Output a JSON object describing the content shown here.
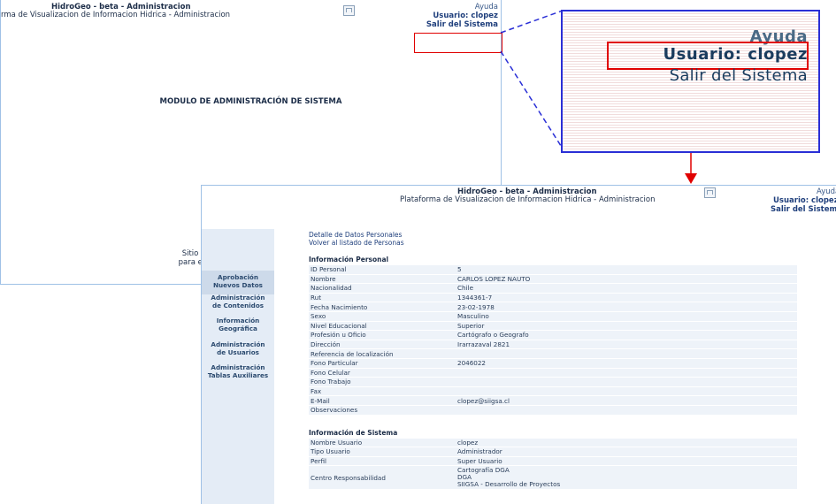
{
  "back_window": {
    "title": "HidroGeo - beta - Administracion",
    "subtitle": "rma de Visualizacion de Informacion Hidrica - Administracion",
    "links": {
      "help": "Ayuda",
      "user": "Usuario: clopez",
      "exit": "Salir del Sistema"
    },
    "module_title": "MODULO DE ADMINISTRACIÓN DE SISTEMA",
    "footer_line1": "Sitio desarrollado para resolución de",
    "footer_line2": "para el navegador Microsoft Internet E"
  },
  "zoom": {
    "help": "Ayuda",
    "user": "Usuario: clopez",
    "exit": "Salir del Sistema"
  },
  "front_window": {
    "title": "HidroGeo - beta - Administracion",
    "subtitle": "Plataforma de Visualizacion de Informacion Hidrica - Administracion",
    "links": {
      "help": "Ayuda",
      "user": "Usuario: clopez",
      "exit": "Salir del Sistema"
    },
    "sidebar": [
      {
        "label1": "Aprobación",
        "label2": "Nuevos Datos"
      },
      {
        "label1": "Administración",
        "label2": "de Contenidos"
      },
      {
        "label1": "Información",
        "label2": "Geográfica"
      },
      {
        "label1": "Administración",
        "label2": "de Usuarios"
      },
      {
        "label1": "Administración",
        "label2": "Tablas Auxiliares"
      }
    ],
    "breadcrumb": {
      "detail": "Detalle de Datos Personales",
      "back": "Volver al listado de Personas"
    },
    "personal": {
      "title": "Información Personal",
      "rows": [
        {
          "k": "ID Personal",
          "v": "5"
        },
        {
          "k": "Nombre",
          "v": "CARLOS LOPEZ NAUTO"
        },
        {
          "k": "Nacionalidad",
          "v": "Chile"
        },
        {
          "k": "Rut",
          "v": "1344361-7"
        },
        {
          "k": "Fecha Nacimiento",
          "v": "23-02-1978"
        },
        {
          "k": "Sexo",
          "v": "Masculino"
        },
        {
          "k": "Nivel Educacional",
          "v": "Superior"
        },
        {
          "k": "Profesión u Oficio",
          "v": "Cartógrafo o Geografo"
        },
        {
          "k": "Dirección",
          "v": "Irarrazaval 2821"
        },
        {
          "k": "Referencia de localización",
          "v": ""
        },
        {
          "k": "Fono Particular",
          "v": "2046022"
        },
        {
          "k": "Fono Celular",
          "v": ""
        },
        {
          "k": "Fono Trabajo",
          "v": ""
        },
        {
          "k": "Fax",
          "v": ""
        },
        {
          "k": "E-Mail",
          "v": "clopez@siigsa.cl"
        },
        {
          "k": "Observaciones",
          "v": ""
        }
      ]
    },
    "system": {
      "title": "Información de Sistema",
      "rows": [
        {
          "k": "Nombre Usuario",
          "v": "clopez"
        },
        {
          "k": "Tipo Usuario",
          "v": "Administrador"
        },
        {
          "k": "Perfil",
          "v": "Super Usuario"
        }
      ],
      "center_label": "Centro Responsabilidad",
      "center_values": [
        "Cartografía DGA",
        "DGA",
        "SIIGSA - Desarrollo de Proyectos"
      ]
    }
  },
  "colors": {
    "accent": "#1f3f7c",
    "highlight_red": "#e00000",
    "callout_blue": "#2a2fd6",
    "sidebar_bg": "#e4ecf6"
  }
}
